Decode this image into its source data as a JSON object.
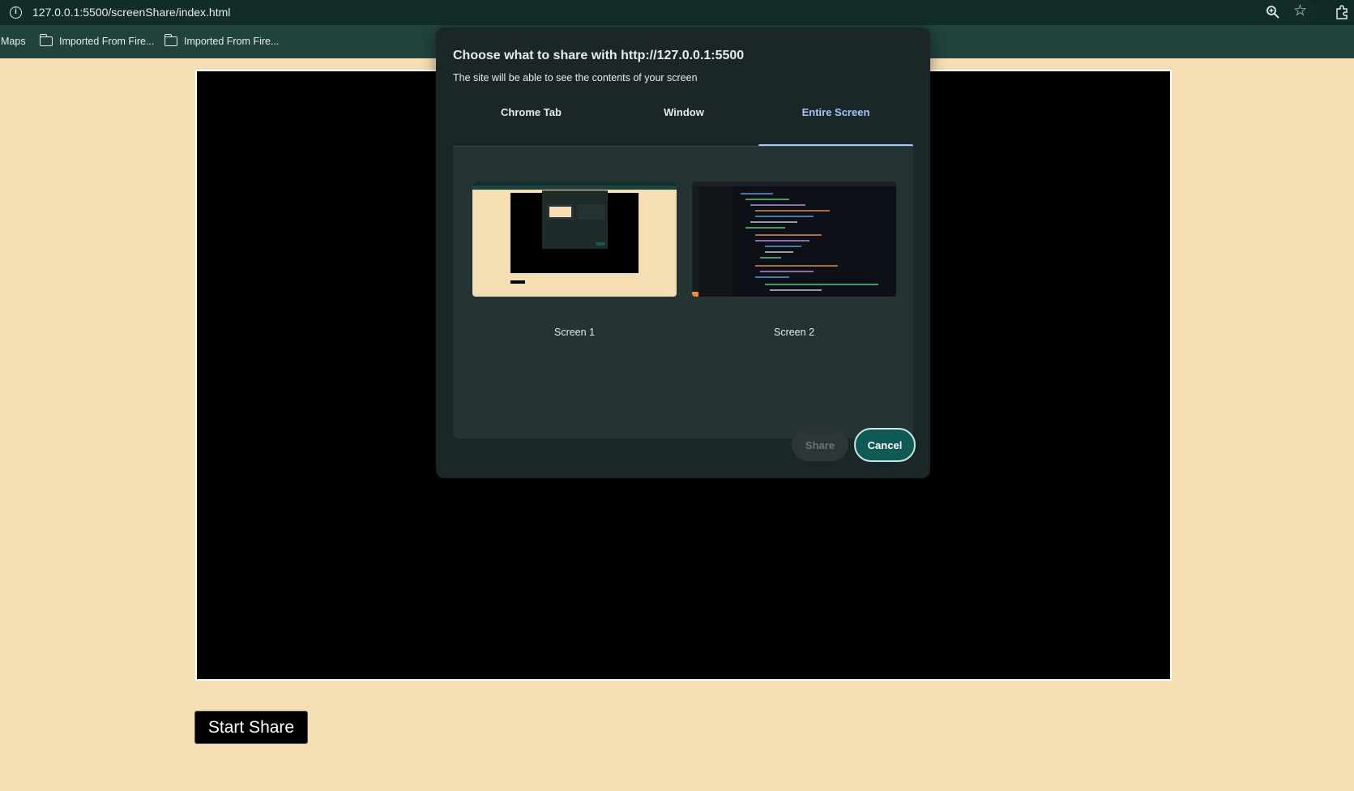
{
  "browser": {
    "url": "127.0.0.1:5500/screenShare/index.html",
    "bookmarks": [
      {
        "label": "Maps"
      },
      {
        "label": "Imported From Fire..."
      },
      {
        "label": "Imported From Fire..."
      }
    ]
  },
  "page": {
    "start_share_label": "Start Share"
  },
  "dialog": {
    "title": "Choose what to share with http://127.0.0.1:5500",
    "subtitle": "The site will be able to see the contents of your screen",
    "tabs": [
      {
        "label": "Chrome Tab",
        "active": false
      },
      {
        "label": "Window",
        "active": false
      },
      {
        "label": "Entire Screen",
        "active": true
      }
    ],
    "sources": [
      {
        "label": "Screen 1"
      },
      {
        "label": "Screen 2"
      }
    ],
    "share_label": "Share",
    "cancel_label": "Cancel"
  },
  "colors": {
    "page_background": "#f5deb3",
    "dialog_background": "#1b2627",
    "accent": "#a8c7fa",
    "cancel_button": "#0f5a54"
  },
  "icons": [
    "info-icon",
    "zoom-icon",
    "star-icon",
    "extensions-icon",
    "folder-icon"
  ]
}
